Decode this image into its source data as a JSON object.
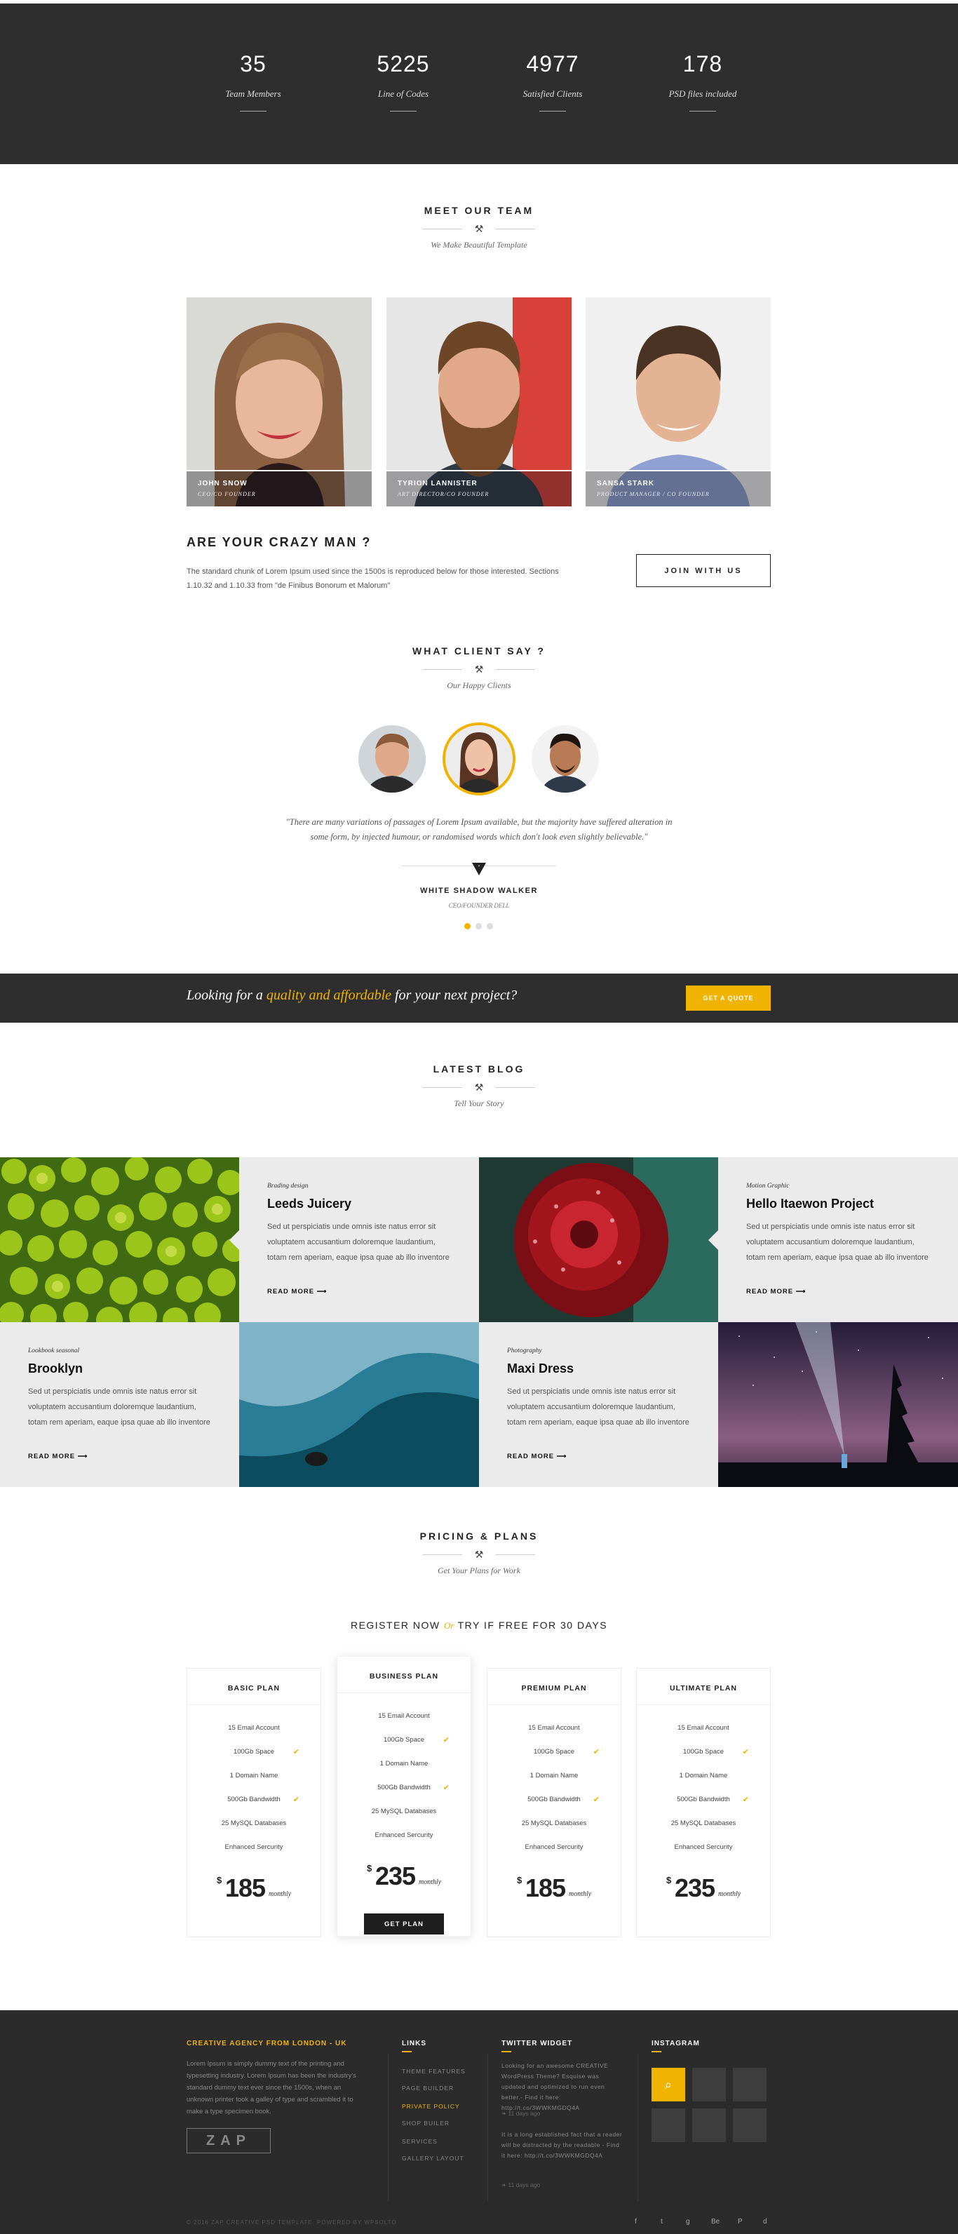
{
  "stats": [
    {
      "number": "35",
      "label": "Team Members"
    },
    {
      "number": "5225",
      "label": "Line of Codes"
    },
    {
      "number": "4977",
      "label": "Satisfied Clients"
    },
    {
      "number": "178",
      "label": "PSD files included"
    }
  ],
  "team": {
    "title": "MEET OUR TEAM",
    "subtitle": "We Make Beautiful Template",
    "members": [
      {
        "name": "JOHN SNOW",
        "role": "CEO/CO FOUNDER"
      },
      {
        "name": "TYRION LANNISTER",
        "role": "ART DIRECTOR/CO FOUNDER"
      },
      {
        "name": "SANSA STARK",
        "role": "PRODUCT MANAGER / CO FOUNDER"
      }
    ]
  },
  "cta": {
    "title": "ARE YOUR CRAZY MAN ?",
    "text": "The standard chunk of Lorem Ipsum used since the 1500s is reproduced below for those interested. Sections 1.10.32 and 1.10.33 from \"de Finibus Bonorum et Malorum\"",
    "button": "JOIN WITH US"
  },
  "clients": {
    "title": "WHAT CLIENT SAY ?",
    "subtitle": "Our Happy Clients",
    "quote": "\"There are many variations of passages of Lorem Ipsum available, but the majority have suffered alteration in some form, by injected humour, or randomised words which don't look even slightly believable.\"",
    "name": "WHITE SHADOW WALKER",
    "role": "CEO/FOUNDER DELL"
  },
  "banner": {
    "pre": "Looking for a ",
    "highlight": "quality and affordable",
    "post": " for your next project?",
    "button": "GET A QUOTE"
  },
  "blog": {
    "title": "LATEST BLOG",
    "subtitle": "Tell Your Story",
    "posts": [
      {
        "category": "Brading design",
        "title": "Leeds Juicery",
        "text": "Sed ut perspiciatis unde omnis iste natus error sit voluptatem accusantium doloremque laudantium, totam rem aperiam, eaque ipsa quae ab illo inventore",
        "more": "READ MORE"
      },
      {
        "category": "Motion Graphic",
        "title": "Hello Itaewon Project",
        "text": "Sed ut perspiciatis unde omnis iste natus error sit voluptatem accusantium doloremque laudantium, totam rem aperiam, eaque ipsa quae ab illo inventore",
        "more": "READ MORE"
      },
      {
        "category": "Lookbook seasonal",
        "title": "Brooklyn",
        "text": "Sed ut perspiciatis unde omnis iste natus error sit voluptatem accusantium doloremque laudantium, totam rem aperiam, eaque ipsa quae ab illo inventore",
        "more": "READ MORE"
      },
      {
        "category": "Photography",
        "title": "Maxi Dress",
        "text": "Sed ut perspiciatis unde omnis iste natus error sit voluptatem accusantium doloremque laudantium, totam rem aperiam, eaque ipsa quae ab illo inventore",
        "more": "READ MORE"
      }
    ]
  },
  "pricing": {
    "title": "PRICING & PLANS",
    "subtitle": "Get Your Plans for Work",
    "register_pre": "REGISTER NOW",
    "register_or": "Or",
    "register_post": "TRY IF FREE FOR 30 DAYS",
    "plans": [
      {
        "name": "BASIC PLAN",
        "features": [
          "15 Email Account",
          "100Gb Space",
          "1 Domain Name",
          "500Gb Bandwidth",
          "25 MySQL Databases",
          "Enhanced Sercurity"
        ],
        "currency": "$",
        "price": "185",
        "period": "monthly"
      },
      {
        "name": "BUSINESS PLAN",
        "features": [
          "15 Email Account",
          "100Gb Space",
          "1 Domain Name",
          "500Gb Bandwidth",
          "25 MySQL Databases",
          "Enhanced Sercurity"
        ],
        "currency": "$",
        "price": "235",
        "period": "monthly",
        "button": "GET PLAN"
      },
      {
        "name": "PREMIUM PLAN",
        "features": [
          "15 Email Account",
          "100Gb Space",
          "1 Domain Name",
          "500Gb Bandwidth",
          "25 MySQL Databases",
          "Enhanced Sercurity"
        ],
        "currency": "$",
        "price": "185",
        "period": "monthly"
      },
      {
        "name": "ULTIMATE PLAN",
        "features": [
          "15 Email Account",
          "100Gb Space",
          "1 Domain Name",
          "500Gb Bandwidth",
          "25 MySQL Databases",
          "Enhanced Sercurity"
        ],
        "currency": "$",
        "price": "235",
        "period": "monthly"
      }
    ]
  },
  "footer": {
    "about_title": "CREATIVE AGENCY FROM LONDON - UK",
    "about_text": "Lorem Ipsum is simply dummy text of the printing and typesetting industry. Lorem Ipsum has been the industry's standard dummy text ever since the 1500s, when an unknown printer took a galley of type and scrambled it to make a type specimen book.",
    "logo": "ZAP",
    "links_title": "LINKS",
    "links": [
      "THEME FEATURES",
      "PAGE BUILDER",
      "PRIVATE POLICY",
      "SHOP BUILER",
      "SERVICES",
      "GALLERY LAYOUT"
    ],
    "twitter_title": "TWITTER WIDGET",
    "tweets": [
      {
        "text": "Looking for an awesome CREATIVE WordPress Theme? Esquise was updated and optimized to run even better.- Find it here: http://t.co/3WWKMGDQ4A",
        "date": "11 days ago"
      },
      {
        "text": "It is a long established fact that a reader will be distracted by the readable - Find it here: http://t.co/3WWKMGDQ4A",
        "date": "11 days ago"
      }
    ],
    "instagram_title": "INSTAGRAM",
    "copyright": "© 2016 ZAP CREATIVE PSD TEMPLATE. POWERED BY WPSOLTO",
    "social": [
      "f",
      "t",
      "g",
      "Be",
      "P",
      "d"
    ]
  },
  "colors": {
    "accent": "#f0b400",
    "dark": "#2e2e2e"
  }
}
